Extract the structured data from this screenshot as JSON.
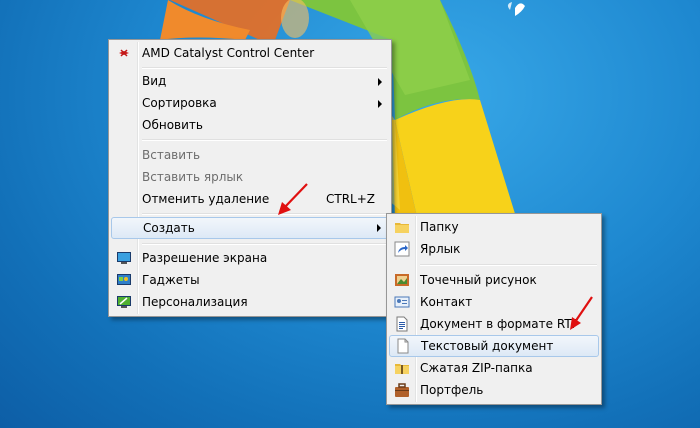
{
  "context_menu": {
    "items": [
      {
        "label": "AMD Catalyst Control Center",
        "icon": "amd-icon"
      },
      {
        "label": "Вид"
      },
      {
        "label": "Сортировка"
      },
      {
        "label": "Обновить"
      },
      {
        "label": "Вставить"
      },
      {
        "label": "Вставить ярлык"
      },
      {
        "label": "Отменить удаление",
        "shortcut": "CTRL+Z"
      },
      {
        "label": "Создать"
      },
      {
        "label": "Разрешение экрана",
        "icon": "display-icon"
      },
      {
        "label": "Гаджеты",
        "icon": "gadgets-icon"
      },
      {
        "label": "Персонализация",
        "icon": "personalize-icon"
      }
    ]
  },
  "submenu": {
    "items": [
      {
        "label": "Папку",
        "icon": "folder-icon"
      },
      {
        "label": "Ярлык",
        "icon": "shortcut-icon"
      },
      {
        "label": "Точечный рисунок",
        "icon": "bitmap-icon"
      },
      {
        "label": "Контакт",
        "icon": "contact-icon"
      },
      {
        "label": "Документ в формате RTF",
        "icon": "rtf-document-icon"
      },
      {
        "label": "Текстовый документ",
        "icon": "text-document-icon"
      },
      {
        "label": "Сжатая ZIP-папка",
        "icon": "zip-folder-icon"
      },
      {
        "label": "Портфель",
        "icon": "briefcase-icon"
      }
    ]
  },
  "colors": {
    "desktop": "#1e88d0",
    "menu_bg": "#f0f0f0",
    "highlight": "#dde9f6",
    "annotation_arrow": "#e01010"
  }
}
